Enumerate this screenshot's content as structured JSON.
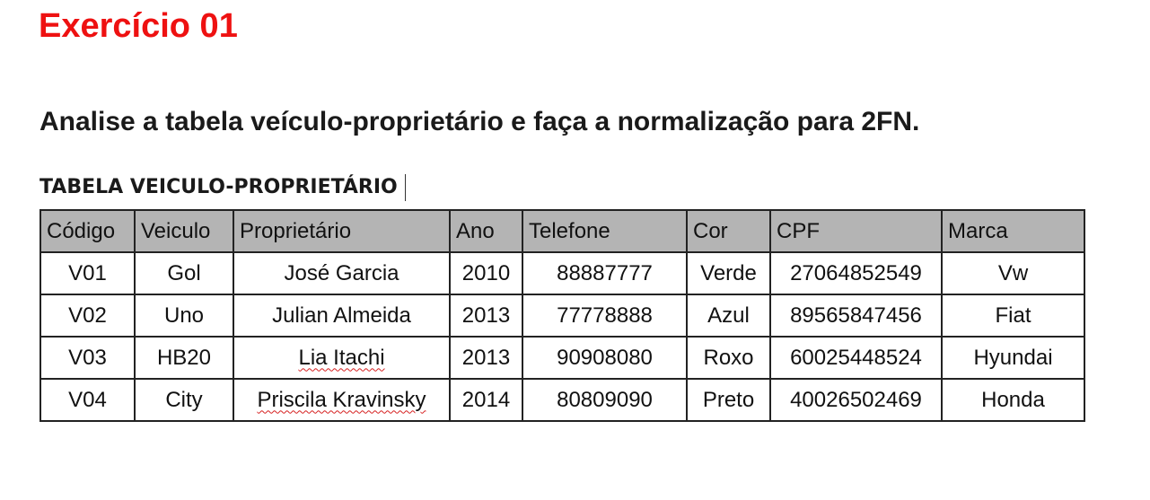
{
  "slide": {
    "title": "Exercício 01",
    "question": "Analise a tabela veículo-proprietário e faça a normalização para 2FN.",
    "table_caption": "TABELA VEICULO-PROPRIETÁRIO"
  },
  "table": {
    "headers": [
      "Código",
      "Veiculo",
      "Proprietário",
      "Ano",
      "Telefone",
      "Cor",
      "CPF",
      "Marca"
    ],
    "rows": [
      [
        "V01",
        "Gol",
        "José Garcia",
        "2010",
        "88887777",
        "Verde",
        "27064852549",
        "Vw"
      ],
      [
        "V02",
        "Uno",
        "Julian Almeida",
        "2013",
        "77778888",
        "Azul",
        "89565847456",
        "Fiat"
      ],
      [
        "V03",
        "HB20",
        "Lia Itachi",
        "2013",
        "90908080",
        "Roxo",
        "60025448524",
        "Hyundai"
      ],
      [
        "V04",
        "City",
        "Priscila Kravinsky",
        "2014",
        "80809090",
        "Preto",
        "40026502469",
        "Honda"
      ]
    ]
  },
  "colors": {
    "title": "#ee1111",
    "header_background": "#b4b4b4",
    "spellcheck_underline": "#d62020"
  }
}
